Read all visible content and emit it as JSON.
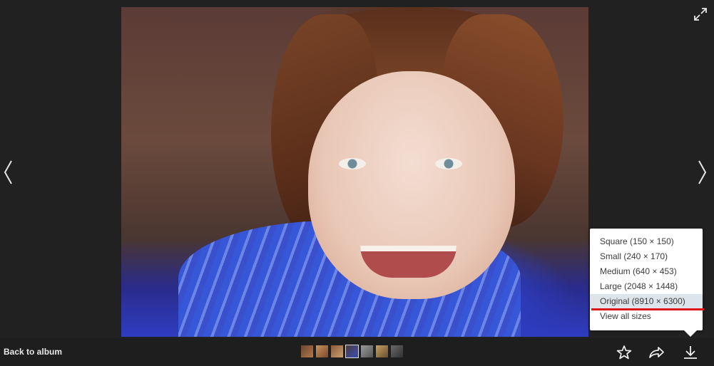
{
  "viewer": {
    "back_label": "Back to album"
  },
  "thumbnails": [
    {
      "name": "thumb-1",
      "color": "#8a5a3a",
      "active": false
    },
    {
      "name": "thumb-2",
      "color": "#b07a4c",
      "active": false
    },
    {
      "name": "thumb-3",
      "color": "#9a6a42",
      "active": false
    },
    {
      "name": "thumb-4",
      "color": "#3a4d8a",
      "active": true
    },
    {
      "name": "thumb-5",
      "color": "#7a7a7a",
      "active": false
    },
    {
      "name": "thumb-6",
      "color": "#a08050",
      "active": false
    },
    {
      "name": "thumb-7",
      "color": "#505050",
      "active": false
    }
  ],
  "download_menu": {
    "items": [
      {
        "label": "Square (150 × 150)"
      },
      {
        "label": "Small (240 × 170)"
      },
      {
        "label": "Medium (640 × 453)"
      },
      {
        "label": "Large (2048 × 1448)"
      },
      {
        "label": "Original (8910 × 6300)",
        "highlighted": true
      }
    ],
    "view_all_label": "View all sizes"
  },
  "icons": {
    "prev": "chevron-left-icon",
    "next": "chevron-right-icon",
    "expand": "expand-icon",
    "favorite": "star-icon",
    "share": "share-arrow-icon",
    "download": "download-icon"
  },
  "colors": {
    "background": "#212121",
    "menu_highlight": "#dde4ea",
    "highlight_underline": "#e01515"
  }
}
